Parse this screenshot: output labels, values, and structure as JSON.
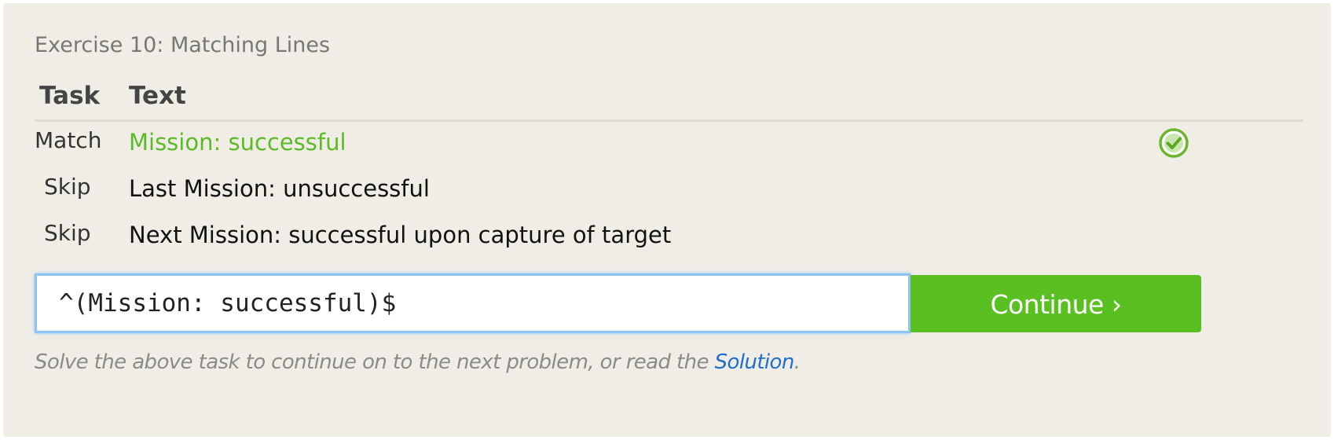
{
  "exercise": {
    "title": "Exercise 10: Matching Lines"
  },
  "table": {
    "headers": {
      "task": "Task",
      "text": "Text"
    },
    "rows": [
      {
        "task": "Match",
        "text": "Mission: successful",
        "matched": true
      },
      {
        "task": "Skip",
        "text": "Last Mission: unsuccessful",
        "matched": false
      },
      {
        "task": "Skip",
        "text": "Next Mission: successful upon capture of target",
        "matched": false
      }
    ]
  },
  "input": {
    "value": "^(Mission: successful)$"
  },
  "continue_button": {
    "label": "Continue ›"
  },
  "hint": {
    "before": "Solve the above task to continue on to the next problem, or read the ",
    "link": "Solution",
    "after": "."
  },
  "icons": {
    "row_status": "check-circle-icon"
  },
  "colors": {
    "accent_green": "#5ac021",
    "match_text": "#5cbb24",
    "link_blue": "#1f6fc8",
    "input_focus": "#8ec3f2",
    "panel_bg": "#efede6"
  }
}
